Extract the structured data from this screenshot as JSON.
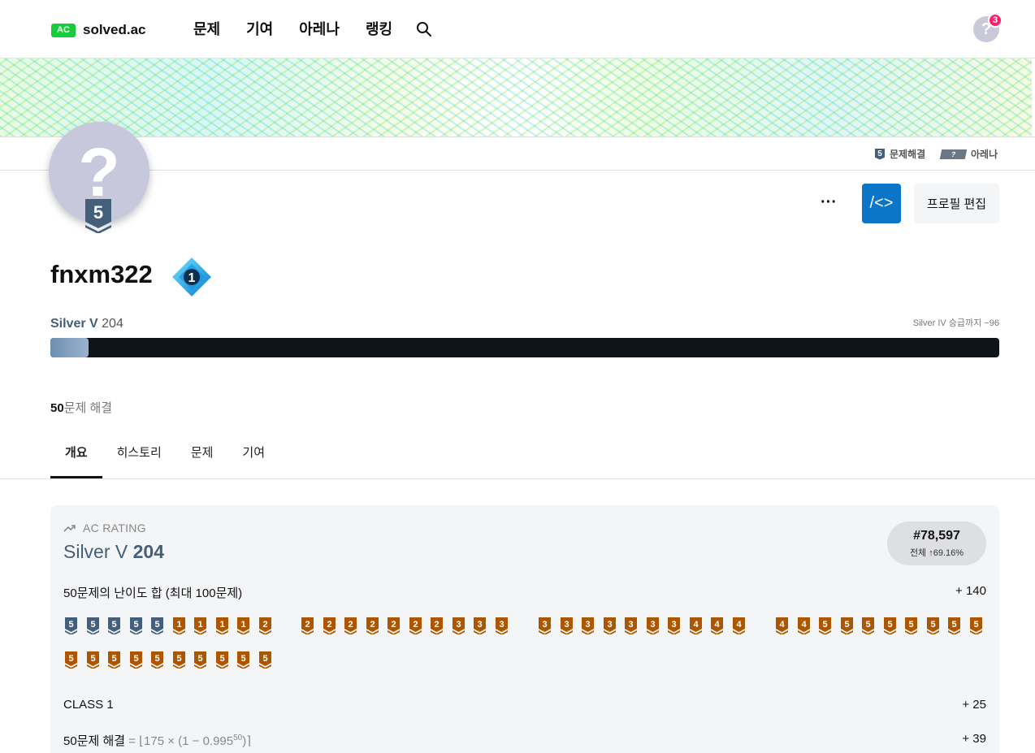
{
  "nav": {
    "logo_badge": "AC",
    "logo_text": "solved.ac",
    "menu": [
      "문제",
      "기여",
      "아레나",
      "랭킹"
    ],
    "avatar_symbol": "?",
    "notification_count": "3"
  },
  "infobar": {
    "solved_tier_digit": "5",
    "solved_label": "문제해결",
    "arena_symbol": "?",
    "arena_label": "아레나"
  },
  "profile": {
    "avatar_symbol": "?",
    "avatar_tier_digit": "5",
    "more_label": "···",
    "code_label": "/<>",
    "edit_label": "프로필 편집",
    "username": "fnxm322",
    "class_digit": "1",
    "tier_name": "Silver V",
    "rating": "204",
    "next_tier": "Silver IV 승급까지 −96",
    "progress_fraction": 0.04,
    "solved_num": "50",
    "solved_text": "문제 해결"
  },
  "tabs": [
    "개요",
    "히스토리",
    "문제",
    "기여"
  ],
  "card": {
    "head": "AC RATING",
    "title_tier": "Silver V",
    "title_rating": "204",
    "rank": "#78,597",
    "rank_sub": "전체 ↑69.16%",
    "sum_label": "50문제의 난이도 합 (최대 100문제)",
    "sum_value": "+ 140",
    "class_label": "CLASS 1",
    "class_value": "+ 25",
    "solved_label": "50문제 해결",
    "solved_formula": "= ⌊175 × (1 − 0.995",
    "solved_exp": "50",
    "solved_formula_end": ")⌉",
    "solved_value": "+ 39"
  },
  "tier_icons": {
    "colors": {
      "silver": "#435f7a",
      "bronze": "#ad5600"
    },
    "row1": [
      {
        "tier": "silver",
        "d": "5"
      },
      {
        "tier": "silver",
        "d": "5"
      },
      {
        "tier": "silver",
        "d": "5"
      },
      {
        "tier": "silver",
        "d": "5"
      },
      {
        "tier": "silver",
        "d": "5"
      },
      {
        "tier": "bronze",
        "d": "1"
      },
      {
        "tier": "bronze",
        "d": "1"
      },
      {
        "tier": "bronze",
        "d": "1"
      },
      {
        "tier": "bronze",
        "d": "1"
      },
      {
        "tier": "bronze",
        "d": "2"
      },
      {
        "tier": "bronze",
        "d": "2"
      },
      {
        "tier": "bronze",
        "d": "2"
      },
      {
        "tier": "bronze",
        "d": "2"
      },
      {
        "tier": "bronze",
        "d": "2"
      },
      {
        "tier": "bronze",
        "d": "2"
      },
      {
        "tier": "bronze",
        "d": "2"
      },
      {
        "tier": "bronze",
        "d": "2"
      },
      {
        "tier": "bronze",
        "d": "3"
      },
      {
        "tier": "bronze",
        "d": "3"
      },
      {
        "tier": "bronze",
        "d": "3"
      },
      {
        "tier": "bronze",
        "d": "3"
      },
      {
        "tier": "bronze",
        "d": "3"
      },
      {
        "tier": "bronze",
        "d": "3"
      },
      {
        "tier": "bronze",
        "d": "3"
      },
      {
        "tier": "bronze",
        "d": "3"
      },
      {
        "tier": "bronze",
        "d": "3"
      },
      {
        "tier": "bronze",
        "d": "3"
      },
      {
        "tier": "bronze",
        "d": "4"
      },
      {
        "tier": "bronze",
        "d": "4"
      },
      {
        "tier": "bronze",
        "d": "4"
      },
      {
        "tier": "bronze",
        "d": "4"
      },
      {
        "tier": "bronze",
        "d": "4"
      },
      {
        "tier": "bronze",
        "d": "5"
      },
      {
        "tier": "bronze",
        "d": "5"
      },
      {
        "tier": "bronze",
        "d": "5"
      },
      {
        "tier": "bronze",
        "d": "5"
      },
      {
        "tier": "bronze",
        "d": "5"
      },
      {
        "tier": "bronze",
        "d": "5"
      },
      {
        "tier": "bronze",
        "d": "5"
      },
      {
        "tier": "bronze",
        "d": "5"
      }
    ],
    "row2": [
      {
        "tier": "bronze",
        "d": "5"
      },
      {
        "tier": "bronze",
        "d": "5"
      },
      {
        "tier": "bronze",
        "d": "5"
      },
      {
        "tier": "bronze",
        "d": "5"
      },
      {
        "tier": "bronze",
        "d": "5"
      },
      {
        "tier": "bronze",
        "d": "5"
      },
      {
        "tier": "bronze",
        "d": "5"
      },
      {
        "tier": "bronze",
        "d": "5"
      },
      {
        "tier": "bronze",
        "d": "5"
      },
      {
        "tier": "bronze",
        "d": "5"
      }
    ]
  }
}
